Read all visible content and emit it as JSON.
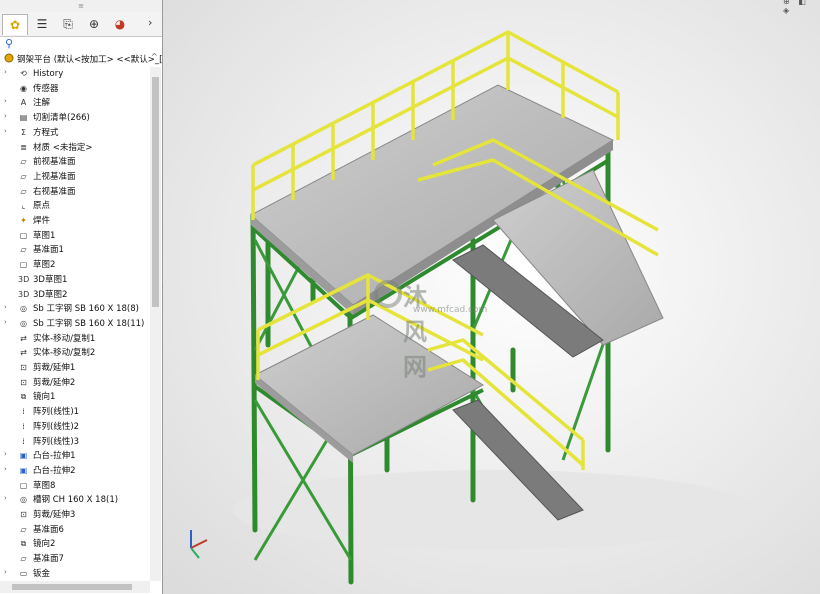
{
  "app": {
    "grip": "≡"
  },
  "tabs": [
    "feature-manager",
    "property-manager",
    "configuration-manager",
    "dimxpert-manager",
    "display-manager"
  ],
  "root": {
    "label": "钢架平台 (默认<按加工> <<默认>_[",
    "chev": "^"
  },
  "tree": [
    {
      "label": "History",
      "exp": true,
      "icon": "history-icon"
    },
    {
      "label": "传感器",
      "exp": false,
      "icon": "sensor-icon"
    },
    {
      "label": "注解",
      "exp": true,
      "icon": "annotation-icon"
    },
    {
      "label": "切割清单(266)",
      "exp": true,
      "icon": "cut-list-icon"
    },
    {
      "label": "方程式",
      "exp": true,
      "icon": "equation-icon"
    },
    {
      "label": "材质 <未指定>",
      "exp": false,
      "icon": "material-icon"
    },
    {
      "label": "前视基准面",
      "exp": false,
      "icon": "plane-icon"
    },
    {
      "label": "上视基准面",
      "exp": false,
      "icon": "plane-icon"
    },
    {
      "label": "右视基准面",
      "exp": false,
      "icon": "plane-icon"
    },
    {
      "label": "原点",
      "exp": false,
      "icon": "origin-icon"
    },
    {
      "label": "焊件",
      "exp": false,
      "icon": "weldment-icon"
    },
    {
      "label": "草图1",
      "exp": false,
      "icon": "sketch-icon"
    },
    {
      "label": "基准面1",
      "exp": false,
      "icon": "plane-icon"
    },
    {
      "label": "草图2",
      "exp": false,
      "icon": "sketch-icon"
    },
    {
      "label": "3D草图1",
      "exp": false,
      "icon": "3d-sketch-icon"
    },
    {
      "label": "3D草图2",
      "exp": false,
      "icon": "3d-sketch-icon"
    },
    {
      "label": "Sb 工字钢 SB 160 X 18(8)",
      "exp": true,
      "icon": "structural-member-icon"
    },
    {
      "label": "Sb 工字钢 SB 160 X 18(11)",
      "exp": true,
      "icon": "structural-member-icon"
    },
    {
      "label": "实体-移动/复制1",
      "exp": false,
      "icon": "move-copy-icon"
    },
    {
      "label": "实体-移动/复制2",
      "exp": false,
      "icon": "move-copy-icon"
    },
    {
      "label": "剪裁/延伸1",
      "exp": false,
      "icon": "trim-extend-icon"
    },
    {
      "label": "剪裁/延伸2",
      "exp": false,
      "icon": "trim-extend-icon"
    },
    {
      "label": "镜向1",
      "exp": false,
      "icon": "mirror-icon"
    },
    {
      "label": "阵列(线性)1",
      "exp": false,
      "icon": "linear-pattern-icon"
    },
    {
      "label": "阵列(线性)2",
      "exp": false,
      "icon": "linear-pattern-icon"
    },
    {
      "label": "阵列(线性)3",
      "exp": false,
      "icon": "linear-pattern-icon"
    },
    {
      "label": "凸台-拉伸1",
      "exp": true,
      "icon": "boss-extrude-icon"
    },
    {
      "label": "凸台-拉伸2",
      "exp": true,
      "icon": "boss-extrude-icon"
    },
    {
      "label": "草图8",
      "exp": false,
      "icon": "sketch-icon"
    },
    {
      "label": "槽钢 CH 160 X 18(1)",
      "exp": true,
      "icon": "structural-member-icon"
    },
    {
      "label": "剪裁/延伸3",
      "exp": false,
      "icon": "trim-extend-icon"
    },
    {
      "label": "基准面6",
      "exp": false,
      "icon": "plane-icon"
    },
    {
      "label": "镜向2",
      "exp": false,
      "icon": "mirror-icon"
    },
    {
      "label": "基准面7",
      "exp": false,
      "icon": "plane-icon"
    },
    {
      "label": "钣金",
      "exp": true,
      "icon": "sheet-metal-icon"
    }
  ],
  "watermark": {
    "text": "沐风网",
    "url": "www.mfcad.com"
  },
  "colors": {
    "frame": "#2f8a2f",
    "rail": "#e4e43a",
    "floor": "#b8b8b8"
  }
}
